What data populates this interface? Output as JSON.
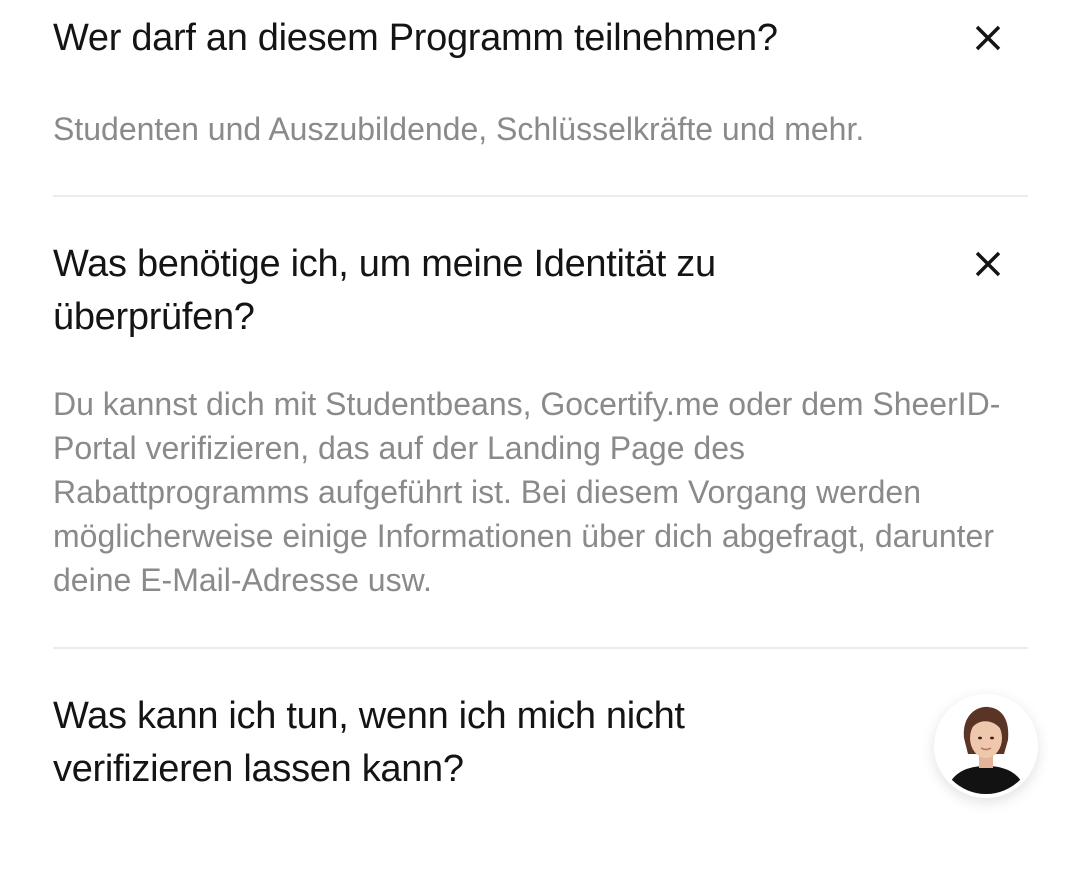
{
  "faq": {
    "items": [
      {
        "question": "Wer darf an diesem Programm teilnehmen?",
        "answer": "Studenten und Auszubildende, Schlüsselkräfte und mehr.",
        "toggle_icon": "close-icon"
      },
      {
        "question": "Was benötige ich, um meine Identität zu überprüfen?",
        "answer": "Du kannst dich mit Studentbeans, Gocertify.me oder dem SheerID-Portal verifizieren, das auf der Landing Page des Rabattprogramms aufgeführt ist. Bei diesem Vorgang werden möglicherweise einige Informationen über dich abgefragt, darunter deine E-Mail-Adresse usw.",
        "toggle_icon": "close-icon"
      },
      {
        "question": "Was kann ich tun, wenn ich mich nicht verifizieren lassen kann?"
      }
    ]
  },
  "chat": {
    "avatar_icon": "support-agent-avatar"
  },
  "colors": {
    "question_text": "#141414",
    "answer_text": "#8a8a8a",
    "divider": "#ebebeb",
    "background": "#ffffff"
  }
}
